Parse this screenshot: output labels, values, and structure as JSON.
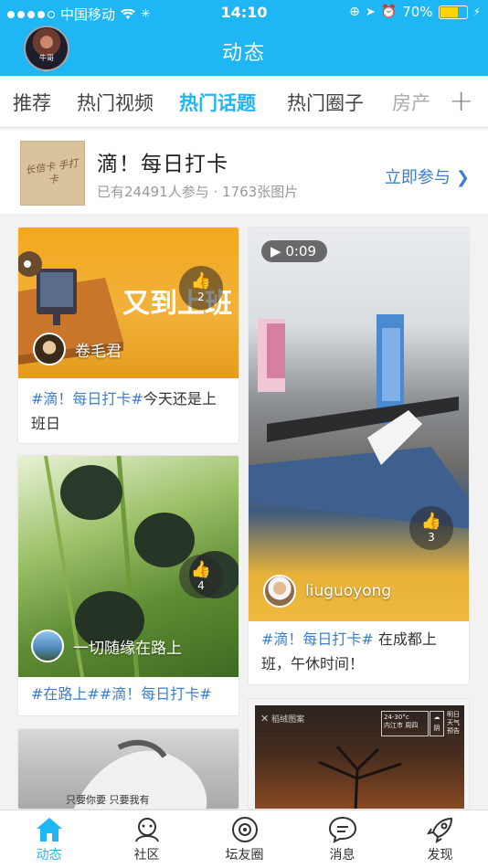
{
  "status_bar": {
    "carrier": "中国移动",
    "time": "14:10",
    "battery": "70%"
  },
  "header": {
    "avatar_tag": "牛哥",
    "title": "动态"
  },
  "tabs": [
    {
      "label": "推荐"
    },
    {
      "label": "热门视频"
    },
    {
      "label": "热门话题"
    },
    {
      "label": "热门圈子"
    },
    {
      "label": "房产"
    }
  ],
  "topic": {
    "thumb_text": "长信卡 手打卡",
    "name": "滴！每日打卡",
    "meta": "已有24491人参与 · 1763张图片",
    "join_label": "立即参与"
  },
  "cards": {
    "c1": {
      "banner_text": "又到上班",
      "likes": "2",
      "user": "卷毛君",
      "caption_tag": "#滴！每日打卡#",
      "caption_text": "今天还是上班日"
    },
    "c2": {
      "duration": "0:09",
      "likes": "3",
      "user": "liuguoyong",
      "caption_tag": "#滴！每日打卡#",
      "caption_text": " 在成都上班，午休时间！"
    },
    "c3": {
      "likes": "4",
      "user": "一切随缘在路上",
      "caption_tag": "#在路上##滴！每日打卡#"
    },
    "c4": {
      "overlay_text": "只要你要 只要我有"
    },
    "c5": {
      "brand": "稻绒图案",
      "temp": "24-30°c",
      "location": "内江市 周四",
      "weather": "阴",
      "forecast": "明日天气预告"
    }
  },
  "bottom_nav": [
    {
      "label": "动态"
    },
    {
      "label": "社区"
    },
    {
      "label": "坛友圈"
    },
    {
      "label": "消息"
    },
    {
      "label": "发现"
    }
  ],
  "colors": {
    "accent": "#1fb6f5",
    "link": "#3c7fc9",
    "battery": "#ffd400"
  }
}
